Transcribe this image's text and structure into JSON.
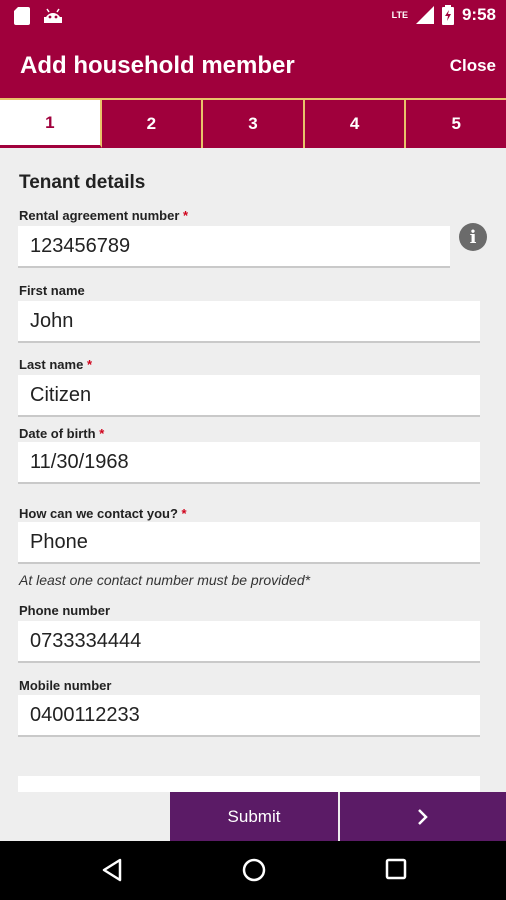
{
  "status_bar": {
    "time": "9:58",
    "network": "LTE"
  },
  "app_bar": {
    "title": "Add household member",
    "close_label": "Close"
  },
  "steps": [
    {
      "label": "1",
      "active": true
    },
    {
      "label": "2",
      "active": false
    },
    {
      "label": "3",
      "active": false
    },
    {
      "label": "4",
      "active": false
    },
    {
      "label": "5",
      "active": false
    }
  ],
  "form": {
    "section_title": "Tenant details",
    "rental_agreement": {
      "label": "Rental agreement number",
      "required_mark": "*",
      "value": "123456789"
    },
    "first_name": {
      "label": "First name",
      "value": "John"
    },
    "last_name": {
      "label": "Last name",
      "required_mark": "*",
      "value": "Citizen"
    },
    "dob": {
      "label": "Date of birth",
      "required_mark": "*",
      "value": "11/30/1968"
    },
    "contact_method": {
      "label": "How can we contact you?",
      "required_mark": "*",
      "value": "Phone"
    },
    "hint": "At least one contact number must be provided*",
    "phone": {
      "label": "Phone number",
      "value": "0733334444"
    },
    "mobile": {
      "label": "Mobile number",
      "value": "0400112233"
    }
  },
  "buttons": {
    "submit_label": "Submit",
    "next_icon": "chevron-right-icon"
  },
  "nav": {
    "back_icon": "back-triangle-icon",
    "home_icon": "home-circle-icon",
    "recents_icon": "recents-square-icon"
  },
  "colors": {
    "primary": "#a0003c",
    "accent": "#5b1b66",
    "tab_divider": "#e8c36a",
    "required": "#d0021b"
  }
}
